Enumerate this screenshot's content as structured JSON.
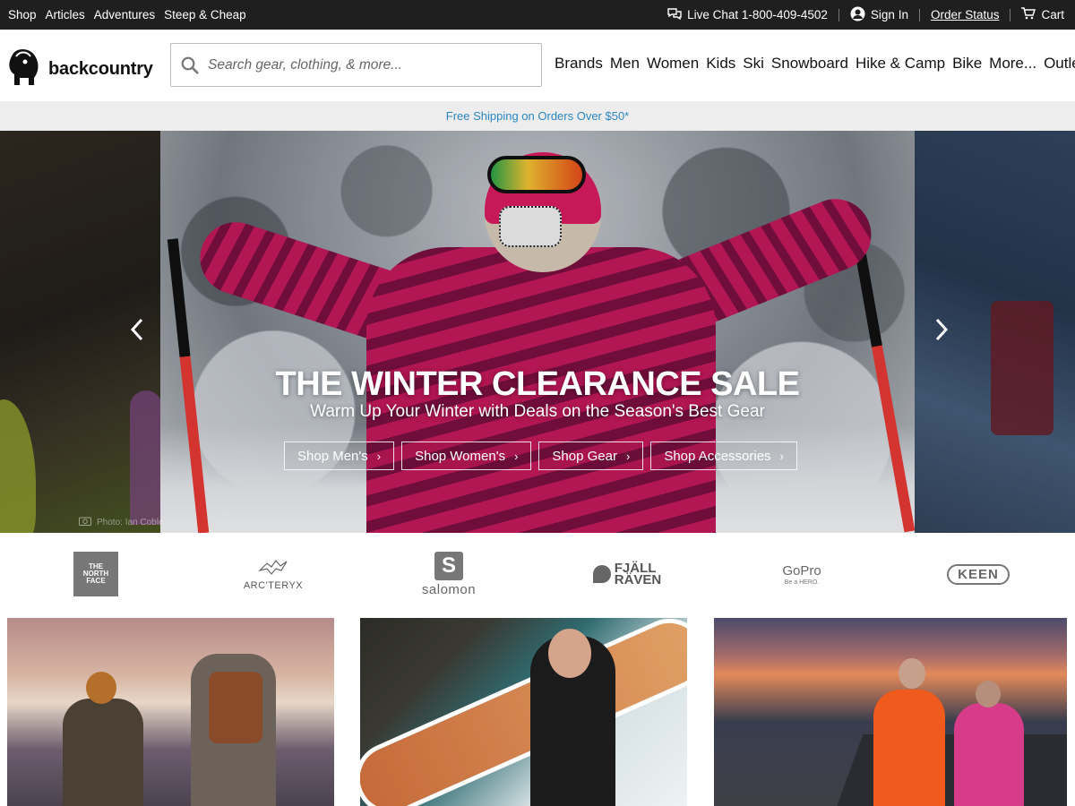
{
  "topbar": {
    "left_links": [
      "Shop",
      "Articles",
      "Adventures",
      "Steep & Cheap"
    ],
    "live_chat": "Live Chat 1-800-409-4502",
    "sign_in": "Sign In",
    "order_status": "Order Status",
    "cart": "Cart"
  },
  "header": {
    "logo_text": "backcountry",
    "search_placeholder": "Search gear, clothing, & more...",
    "nav": [
      "Brands",
      "Men",
      "Women",
      "Kids",
      "Ski",
      "Snowboard",
      "Hike & Camp",
      "Bike",
      "More...",
      "Outlet"
    ]
  },
  "promo": {
    "text": "Free Shipping on Orders Over $50*",
    "color": "#2a86c0"
  },
  "hero": {
    "title": "THE WINTER CLEARANCE SALE",
    "subtitle": "Warm Up Your Winter with Deals on the Season's Best Gear",
    "ctas": [
      "Shop Men's",
      "Shop Women's",
      "Shop Gear",
      "Shop Accessories"
    ],
    "photo_credit": "Photo: Ian Coble",
    "prev_icon": "chevron-left-icon",
    "next_icon": "chevron-right-icon"
  },
  "brands": {
    "tnf": [
      "THE",
      "NORTH",
      "FACE"
    ],
    "arcteryx": "ARC'TERYX",
    "salomon_letter": "S",
    "salomon": "salomon",
    "fjallraven": [
      "FJÄLL",
      "RÄVEN"
    ],
    "gopro": "GoPro",
    "gopro_tagline": "Be a HERO.",
    "keen": "KEEN"
  },
  "colors": {
    "topbar_bg": "#1f1f1f",
    "promo_bg": "#ededed",
    "accent_link": "#2a86c0"
  }
}
